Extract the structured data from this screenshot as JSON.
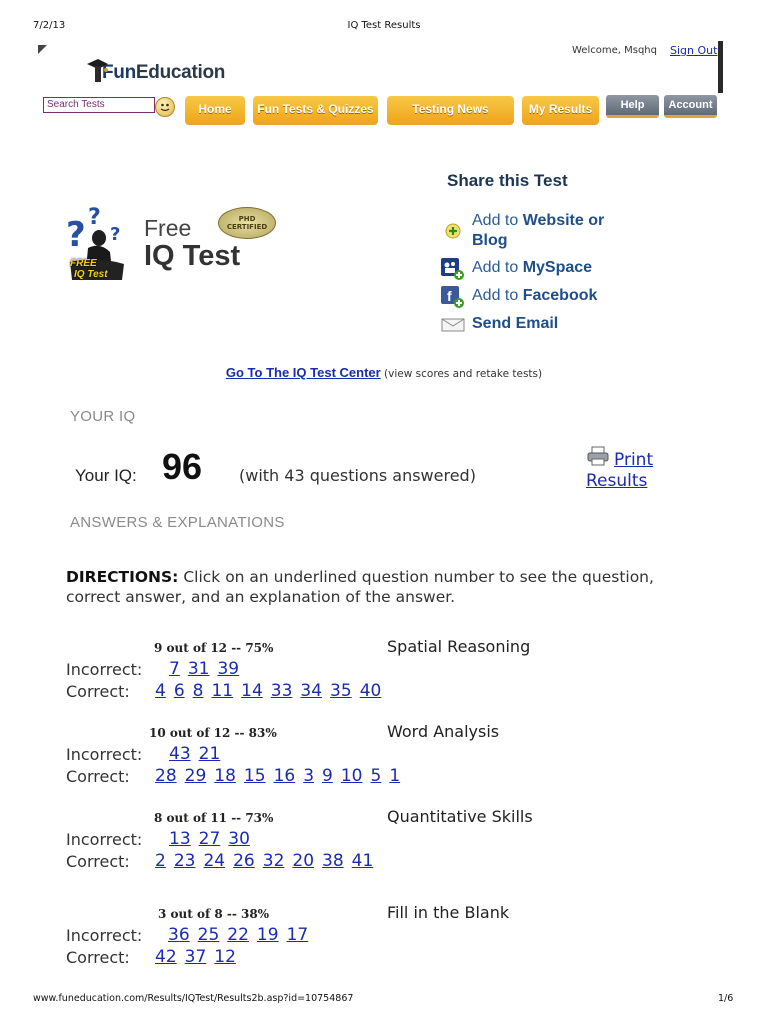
{
  "print_header": {
    "date": "7/2/13",
    "title": "IQ Test Results"
  },
  "print_footer": {
    "url": "www.funeducation.com/Results/IQTest/Results2b.asp?id=10754867",
    "page": "1/6"
  },
  "site": {
    "logo_prefix": "Fun",
    "logo_suffix": "Education",
    "welcome": "Welcome, Msqhq",
    "sign_out": "Sign Out"
  },
  "search": {
    "placeholder": "Search Tests"
  },
  "nav": {
    "home": "Home",
    "fun_tests": "Fun Tests & Quizzes",
    "testing_news": "Testing News",
    "my_results": "My Results",
    "help": "Help",
    "account": "Account"
  },
  "test_logo": {
    "badge": "PHD CERTIFIED",
    "free": "Free",
    "name": "IQ Test",
    "figure_label_1": "FREE",
    "figure_label_2": "IQ Test"
  },
  "share": {
    "title": "Share this Test",
    "website_prefix": "Add to ",
    "website_bold": "Website or",
    "website_bold_2": "Blog",
    "myspace_prefix": "Add to ",
    "myspace_bold": "MySpace",
    "facebook_prefix": "Add to ",
    "facebook_bold": "Facebook",
    "email": "Send Email"
  },
  "center_link": {
    "text": "Go To The IQ Test Center",
    "note": "(view scores and retake tests)"
  },
  "your_iq": {
    "section_label": "YOUR IQ",
    "label": "Your IQ:",
    "score": "96",
    "answered": "(with 43 questions answered)"
  },
  "print": {
    "line1": "Print",
    "line2": "Results"
  },
  "answers": {
    "section_label": "ANSWERS & EXPLANATIONS",
    "directions_label": "DIRECTIONS:",
    "directions_text": "Click on an underlined question number to see the question,",
    "directions_text_2": "correct answer, and an explanation of the answer.",
    "incorrect_label": "Incorrect:",
    "correct_label": "Correct:"
  },
  "categories": [
    {
      "title": "Spatial Reasoning",
      "score": "9 out of 12 -- 75%",
      "incorrect": [
        "7",
        "31",
        "39"
      ],
      "correct": [
        "4",
        "6",
        "8",
        "11",
        "14",
        "33",
        "34",
        "35",
        "40"
      ]
    },
    {
      "title": "Word Analysis",
      "score": "10 out of 12 -- 83%",
      "incorrect": [
        "43",
        "21"
      ],
      "correct": [
        "28",
        "29",
        "18",
        "15",
        "16",
        "3",
        "9",
        "10",
        "5",
        "1"
      ]
    },
    {
      "title": "Quantitative Skills",
      "score": "8 out of 11 -- 73%",
      "incorrect": [
        "13",
        "27",
        "30"
      ],
      "correct": [
        "2",
        "23",
        "24",
        "26",
        "32",
        "20",
        "38",
        "41"
      ]
    },
    {
      "title": "Fill in the Blank",
      "score": "3 out of 8 -- 38%",
      "incorrect": [
        "36",
        "25",
        "22",
        "19",
        "17"
      ],
      "correct": [
        "42",
        "37",
        "12"
      ]
    }
  ]
}
